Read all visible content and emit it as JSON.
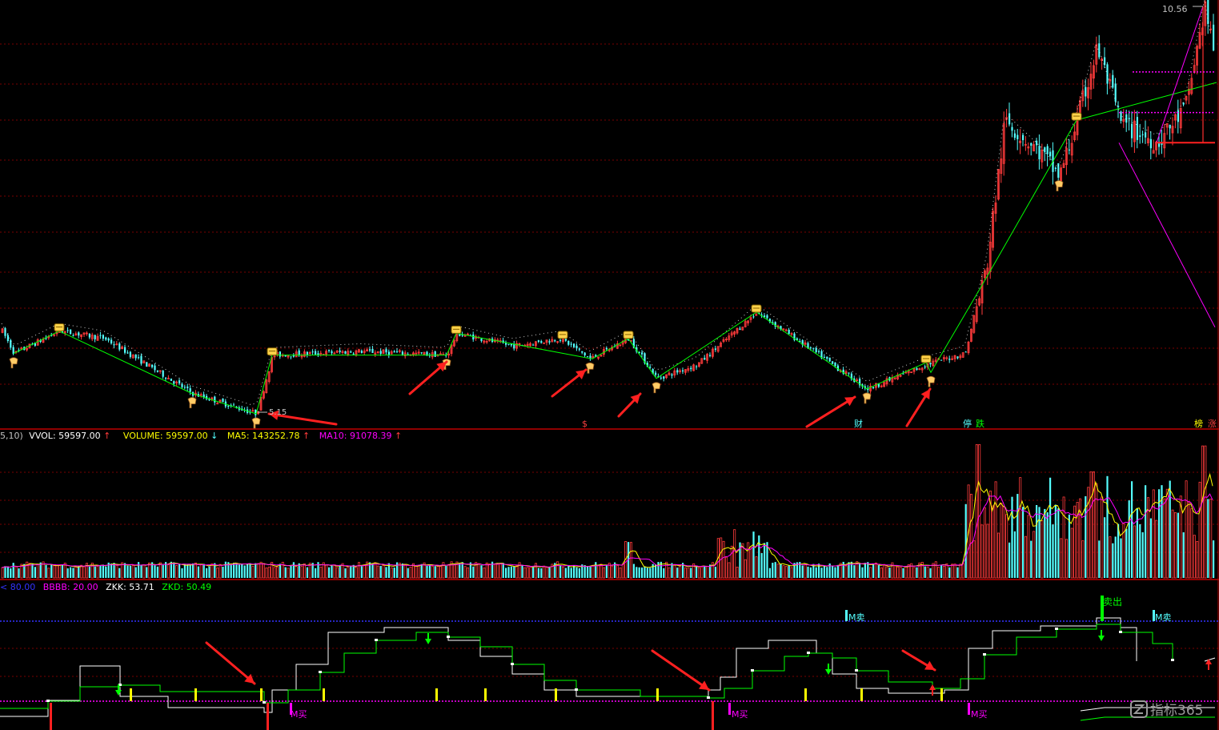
{
  "colors": {
    "up": "#ff3b3b",
    "down": "#54ffff",
    "zigzag": "#00ff00",
    "magenta": "#ff00ff",
    "yellow": "#ffff00",
    "white": "#ffffff",
    "grid": "#7a0000",
    "blue_level": "#3333ff",
    "arrow": "#ff2020"
  },
  "price_panel": {
    "high_label": "10.56",
    "low_label": "5.15",
    "markers": [
      {
        "text": "$",
        "color": "#ff4040"
      },
      {
        "text": "财",
        "color": "#54ffff"
      },
      {
        "text": "停",
        "color": "#54ffff"
      },
      {
        "text": "跌",
        "color": "#00ff00"
      },
      {
        "text": "榜",
        "color": "#ffff00"
      },
      {
        "text": "涨",
        "color": "#ff4040"
      }
    ]
  },
  "volume_panel": {
    "header": [
      {
        "text": "5,10)",
        "color": "#c0c0c0"
      },
      {
        "text": "VVOL: 59597.00",
        "color": "#ffffff"
      },
      {
        "text": "↑",
        "color": "#ff3b3b"
      },
      {
        "text": "VOLUME: 59597.00",
        "color": "#ffff00"
      },
      {
        "text": "↓",
        "color": "#54ffff"
      },
      {
        "text": "MA5: 143252.78",
        "color": "#ffff00"
      },
      {
        "text": "↑",
        "color": "#ff3b3b"
      },
      {
        "text": "MA10: 91078.39",
        "color": "#ff00ff"
      },
      {
        "text": "↑",
        "color": "#ff3b3b"
      }
    ]
  },
  "indicator_panel": {
    "header": [
      {
        "text": "< 80.00",
        "color": "#3333ff"
      },
      {
        "text": "BBBB: 20.00",
        "color": "#ff00ff"
      },
      {
        "text": "ZKK: 53.71",
        "color": "#ffffff"
      },
      {
        "text": "ZKD: 50.49",
        "color": "#00ff00"
      }
    ],
    "labels": [
      {
        "text": "M买",
        "color": "#ff00ff"
      },
      {
        "text": "M买",
        "color": "#ff00ff"
      },
      {
        "text": "M买",
        "color": "#ff00ff"
      },
      {
        "text": "M卖",
        "color": "#54ffff"
      },
      {
        "text": "M卖",
        "color": "#54ffff"
      },
      {
        "text": "卖出",
        "color": "#00ff00"
      }
    ]
  },
  "watermark": {
    "text": "指标365"
  },
  "chart_data": {
    "type": "candlestick",
    "price_range": [
      5.15,
      10.56
    ],
    "zigzag_prices": [
      5.95,
      6.25,
      5.42,
      5.15,
      5.93,
      5.93,
      6.22,
      5.95,
      6.15,
      5.88,
      6.15,
      5.62,
      6.5,
      5.95,
      5.48,
      5.83,
      5.7,
      9.05,
      8.3,
      9.05,
      10.0,
      8.75
    ],
    "volume_ma5": 143252.78,
    "volume_ma10": 91078.39,
    "volume_last": 59597.0,
    "zkk_last": 53.71,
    "zkd_last": 50.49,
    "upper_level": 80.0,
    "lower_level": 20.0
  }
}
